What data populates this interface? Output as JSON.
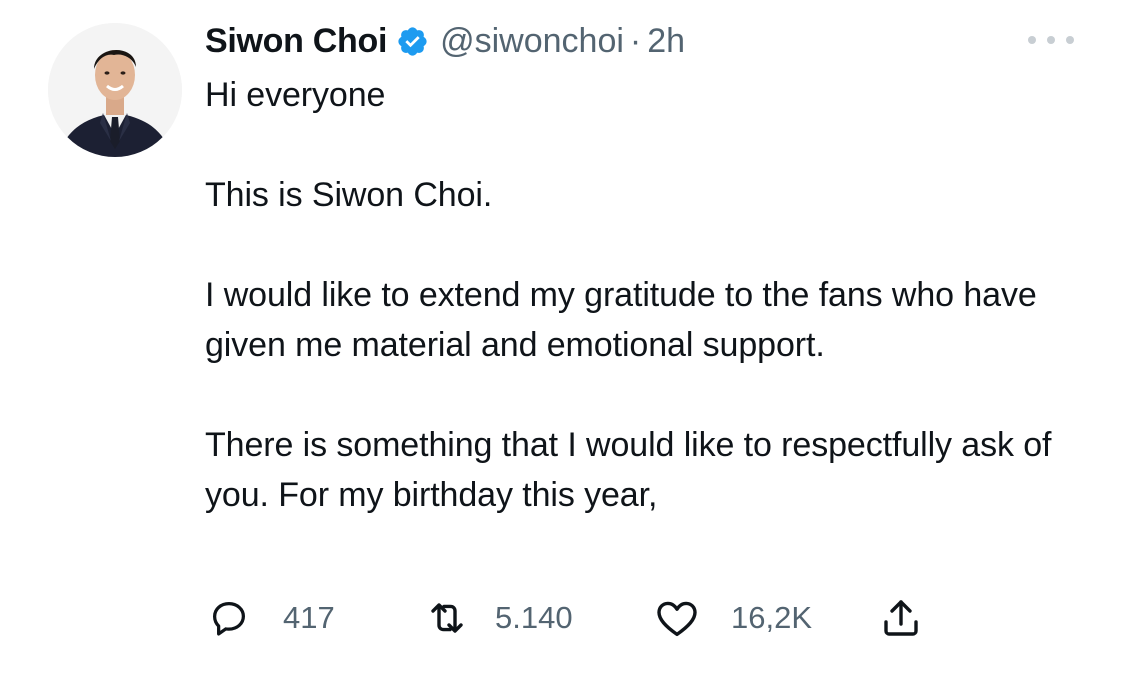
{
  "tweet": {
    "author": {
      "display_name": "Siwon Choi",
      "handle": "@siwonchoi",
      "verified": true
    },
    "separator": "·",
    "time": "2h",
    "paragraphs": [
      "Hi everyone",
      "This is Siwon Choi.",
      "I would like to extend my gratitude to the fans who have given me material and emotional support.",
      "There is something that I would like to respectfully ask of you. For my birthday this year,"
    ],
    "stats": {
      "replies": "417",
      "retweets": "5.140",
      "likes": "16,2K"
    }
  },
  "colors": {
    "text": "#0f1419",
    "secondary": "#536471",
    "verified_blue": "#1d9bf0",
    "background": "#ffffff"
  },
  "icons": {
    "reply": "reply-icon",
    "retweet": "retweet-icon",
    "like": "heart-icon",
    "share": "share-icon",
    "more": "more-icon",
    "verified": "verified-badge-icon"
  }
}
